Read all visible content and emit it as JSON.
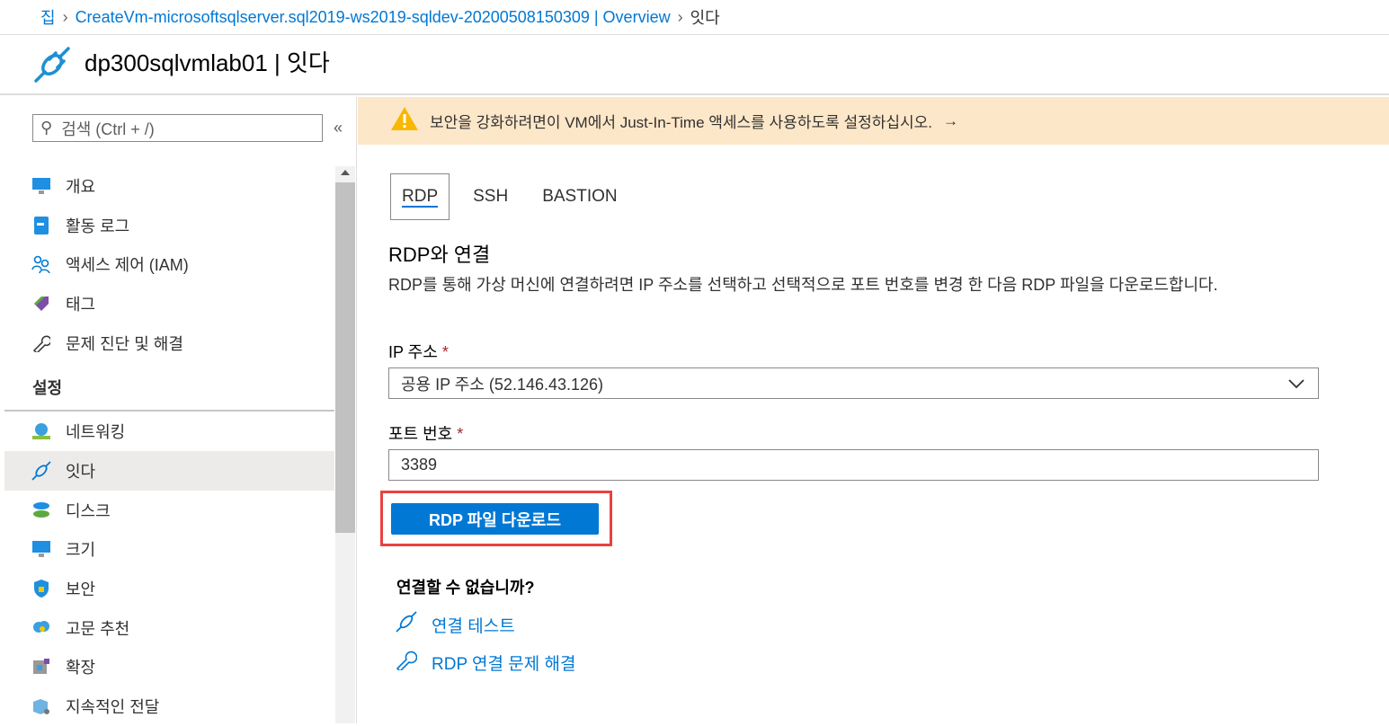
{
  "breadcrumb": {
    "home": "집",
    "parent": "CreateVm-microsoftsqlserver.sql2019-ws2019-sqldev-20200508150309 | Overview",
    "current": "잇다"
  },
  "header": {
    "title": "dp300sqlvmlab01 | 잇다"
  },
  "sidebar": {
    "search_placeholder": "검색 (Ctrl + /)",
    "collapse": "«",
    "items": [
      {
        "label": "개요"
      },
      {
        "label": "활동 로그"
      },
      {
        "label": "액세스 제어 (IAM)"
      },
      {
        "label": "태그"
      },
      {
        "label": "문제 진단 및 해결"
      }
    ],
    "section": "설정",
    "settings": [
      {
        "label": "네트워킹"
      },
      {
        "label": "잇다"
      },
      {
        "label": "디스크"
      },
      {
        "label": "크기"
      },
      {
        "label": "보안"
      },
      {
        "label": "고문 추천"
      },
      {
        "label": "확장"
      },
      {
        "label": "지속적인 전달"
      }
    ]
  },
  "banner": {
    "text": "보안을 강화하려면이 VM에서 Just-In-Time 액세스를 사용하도록 설정하십시오.",
    "arrow": "→"
  },
  "tabs": [
    "RDP",
    "SSH",
    "BASTION"
  ],
  "content": {
    "heading": "RDP와 연결",
    "description": "RDP를 통해 가상 머신에 연결하려면 IP 주소를 선택하고 선택적으로 포트 번호를 변경 한 다음 RDP 파일을 다운로드합니다.",
    "ip_label": "IP 주소",
    "ip_value": "공용 IP 주소 (52.146.43.126)",
    "port_label": "포트 번호",
    "port_value": "3389",
    "required": "*",
    "download_button": "RDP 파일 다운로드",
    "cant_connect": "연결할 수 없습니까?",
    "link_test": "연결 테스트",
    "link_troubleshoot": "RDP 연결 문제 해결"
  }
}
